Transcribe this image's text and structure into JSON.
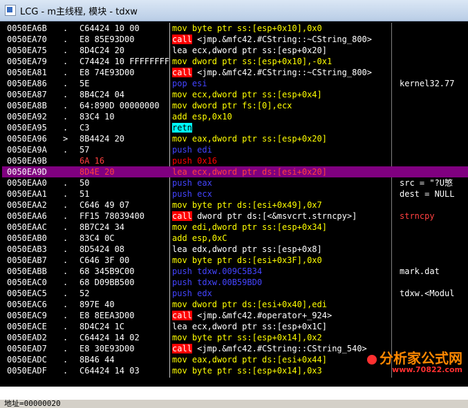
{
  "window": {
    "title": "LCG - m主线程, 模块 - tdxw"
  },
  "colors": {
    "mov": "#ffff00",
    "call_bg": "#ff0000",
    "call_fg": "#ffffff",
    "push": "#4444ff",
    "lea": "#ffffff",
    "retn_bg": "#00ffff",
    "pop": "#4444ff",
    "highlight": "#800080",
    "hl_text": "#ff4040"
  },
  "rows": [
    {
      "addr": "0050EA6B",
      "mark": ".",
      "hex": "C64424 10 00",
      "kind": "mov",
      "dis": "mov byte ptr ss:[esp+0x10],0x0",
      "cmt": ""
    },
    {
      "addr": "0050EA70",
      "mark": ".",
      "hex": "E8 85E93D00",
      "kind": "call",
      "dis": "call <jmp.&mfc42.#CString::~CString_800>",
      "cmt": ""
    },
    {
      "addr": "0050EA75",
      "mark": ".",
      "hex": "8D4C24 20",
      "kind": "lea",
      "dis": "lea ecx,dword ptr ss:[esp+0x20]",
      "cmt": ""
    },
    {
      "addr": "0050EA79",
      "mark": ".",
      "hex": "C74424 10 FFFFFFFF",
      "kind": "mov",
      "dis": "mov dword ptr ss:[esp+0x10],-0x1",
      "cmt": ""
    },
    {
      "addr": "0050EA81",
      "mark": ".",
      "hex": "E8 74E93D00",
      "kind": "call",
      "dis": "call <jmp.&mfc42.#CString::~CString_800>",
      "cmt": ""
    },
    {
      "addr": "0050EA86",
      "mark": ".",
      "hex": "5E",
      "kind": "pop",
      "dis": "pop esi",
      "cmt": "kernel32.77"
    },
    {
      "addr": "0050EA87",
      "mark": ".",
      "hex": "8B4C24 04",
      "kind": "mov",
      "dis": "mov ecx,dword ptr ss:[esp+0x4]",
      "cmt": ""
    },
    {
      "addr": "0050EA8B",
      "mark": ".",
      "hex": "64:890D 00000000",
      "kind": "mov",
      "dis": "mov dword ptr fs:[0],ecx",
      "cmt": ""
    },
    {
      "addr": "0050EA92",
      "mark": ".",
      "hex": "83C4 10",
      "kind": "add",
      "dis": "add esp,0x10",
      "cmt": ""
    },
    {
      "addr": "0050EA95",
      "mark": ".",
      "hex": "C3",
      "kind": "retn",
      "dis": "retn",
      "cmt": ""
    },
    {
      "addr": "0050EA96",
      "mark": ">",
      "hex": "8B4424 20",
      "kind": "mov",
      "dis": "mov eax,dword ptr ss:[esp+0x20]",
      "cmt": ""
    },
    {
      "addr": "0050EA9A",
      "mark": ".",
      "hex": "57",
      "kind": "push",
      "dis": "push edi",
      "cmt": ""
    },
    {
      "addr": "0050EA9B",
      "mark": "",
      "hex": "6A 16",
      "kind": "pushred",
      "dis": "push 0x16",
      "cmt": ""
    },
    {
      "addr": "0050EA9D",
      "mark": "",
      "hex": "8D4E 20",
      "kind": "hl",
      "dis": "lea ecx,dword ptr ds:[esi+0x20]",
      "cmt": ""
    },
    {
      "addr": "0050EAA0",
      "mark": ".",
      "hex": "50",
      "kind": "push",
      "dis": "push eax",
      "cmt": "src = \"?U慜"
    },
    {
      "addr": "0050EAA1",
      "mark": ".",
      "hex": "51",
      "kind": "push",
      "dis": "push ecx",
      "cmt": "dest = NULL"
    },
    {
      "addr": "0050EAA2",
      "mark": ".",
      "hex": "C646 49 07",
      "kind": "mov",
      "dis": "mov byte ptr ds:[esi+0x49],0x7",
      "cmt": ""
    },
    {
      "addr": "0050EAA6",
      "mark": ".",
      "hex": "FF15 78039400",
      "kind": "call",
      "dis": "call dword ptr ds:[<&msvcrt.strncpy>]",
      "cmt": "strncpy"
    },
    {
      "addr": "0050EAAC",
      "mark": ".",
      "hex": "8B7C24 34",
      "kind": "mov",
      "dis": "mov edi,dword ptr ss:[esp+0x34]",
      "cmt": ""
    },
    {
      "addr": "0050EAB0",
      "mark": ".",
      "hex": "83C4 0C",
      "kind": "add",
      "dis": "add esp,0xC",
      "cmt": ""
    },
    {
      "addr": "0050EAB3",
      "mark": ".",
      "hex": "8D5424 08",
      "kind": "lea",
      "dis": "lea edx,dword ptr ss:[esp+0x8]",
      "cmt": ""
    },
    {
      "addr": "0050EAB7",
      "mark": ".",
      "hex": "C646 3F 00",
      "kind": "mov",
      "dis": "mov byte ptr ds:[esi+0x3F],0x0",
      "cmt": ""
    },
    {
      "addr": "0050EABB",
      "mark": ".",
      "hex": "68 345B9C00",
      "kind": "push",
      "dis": "push tdxw.009C5B34",
      "cmt": "mark.dat"
    },
    {
      "addr": "0050EAC0",
      "mark": ".",
      "hex": "68 D09BB500",
      "kind": "push",
      "dis": "push tdxw.00B59BD0",
      "cmt": ""
    },
    {
      "addr": "0050EAC5",
      "mark": ".",
      "hex": "52",
      "kind": "push",
      "dis": "push edx",
      "cmt": "tdxw.<Modul"
    },
    {
      "addr": "0050EAC6",
      "mark": ".",
      "hex": "897E 40",
      "kind": "mov",
      "dis": "mov dword ptr ds:[esi+0x40],edi",
      "cmt": ""
    },
    {
      "addr": "0050EAC9",
      "mark": ".",
      "hex": "E8 8EEA3D00",
      "kind": "call",
      "dis": "call <jmp.&mfc42.#operator+_924>",
      "cmt": ""
    },
    {
      "addr": "0050EACE",
      "mark": ".",
      "hex": "8D4C24 1C",
      "kind": "lea",
      "dis": "lea ecx,dword ptr ss:[esp+0x1C]",
      "cmt": ""
    },
    {
      "addr": "0050EAD2",
      "mark": ".",
      "hex": "C64424 14 02",
      "kind": "mov",
      "dis": "mov byte ptr ss:[esp+0x14],0x2",
      "cmt": ""
    },
    {
      "addr": "0050EAD7",
      "mark": ".",
      "hex": "E8 30E93D00",
      "kind": "call",
      "dis": "call <jmp.&mfc42.#CString::CString_540>",
      "cmt": ""
    },
    {
      "addr": "0050EADC",
      "mark": ".",
      "hex": "8B46 44",
      "kind": "mov",
      "dis": "mov eax,dword ptr ds:[esi+0x44]",
      "cmt": ""
    },
    {
      "addr": "0050EADF",
      "mark": ".",
      "hex": "C64424 14 03",
      "kind": "mov",
      "dis": "mov byte ptr ss:[esp+0x14],0x3",
      "cmt": ""
    }
  ],
  "status": {
    "text": "地址=00000020"
  },
  "watermark": {
    "name": "分析家公式网",
    "url": "www.70822.com"
  }
}
